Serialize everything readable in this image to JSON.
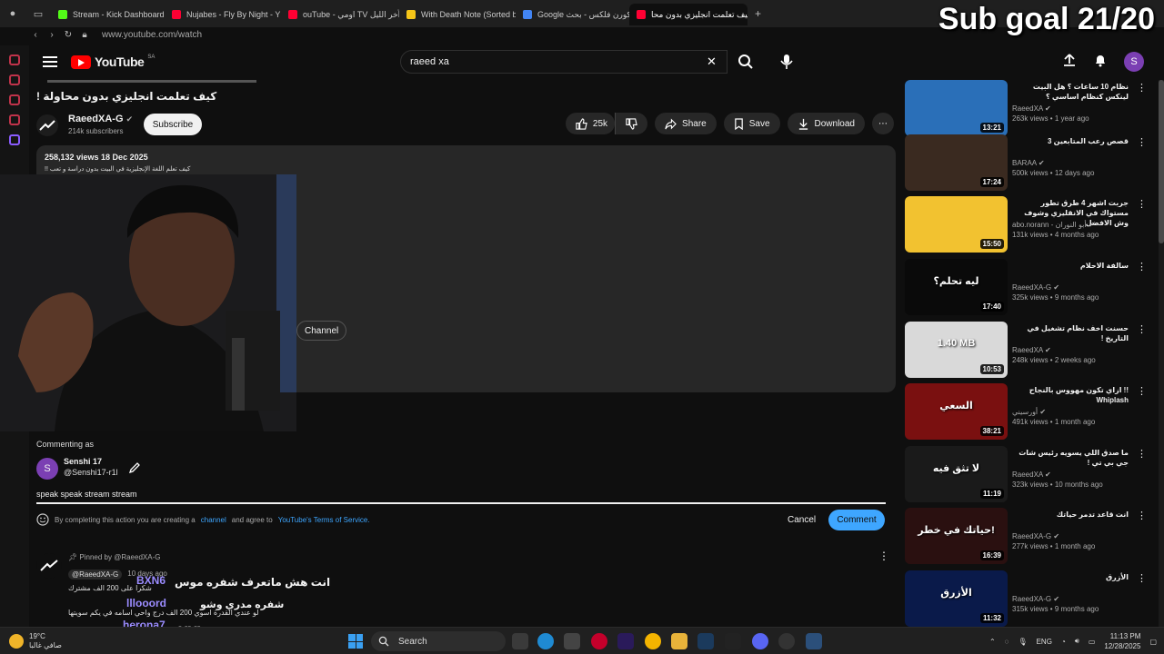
{
  "overlay": {
    "sub_goal": "Sub goal 21/20"
  },
  "browser": {
    "tabs": [
      {
        "label": "Stream - Kick Dashboard",
        "color": "#53fc18"
      },
      {
        "label": "Nujabes - Fly By Night - Y",
        "color": "#ff0033"
      },
      {
        "label": "ouTube - اومي TV آخر الليل",
        "color": "#ff0033"
      },
      {
        "label": "With Death Note (Sorted b",
        "color": "#f5c518"
      },
      {
        "label": "Google كورن فلكس - بحث",
        "color": "#4285f4"
      },
      {
        "label": "كيف تعلمت انجليزي بدون محا",
        "color": "#ff0033",
        "active": true
      }
    ],
    "url": "www.youtube.com/watch"
  },
  "youtube": {
    "logo_text": "YouTube",
    "country": "SA",
    "search_value": "raeed xa",
    "avatar_letter": "S"
  },
  "video": {
    "title": "كيف تعلمت انجليزي بدون محاولة !",
    "channel": "RaeedXA-G",
    "subscribers": "214k subscribers",
    "subscribe_label": "Subscribe",
    "likes": "25k",
    "share_label": "Share",
    "save_label": "Save",
    "download_label": "Download",
    "stats": "258,132 views  18 Dec 2025",
    "description": "كيف تعلم اللغة الإنجليزية في البيت بدون دراسة و تعب !!",
    "channel_pill": "Channel"
  },
  "composer": {
    "commenting_as": "Commenting as",
    "name": "Senshi 17",
    "handle": "@Senshi17-r1l",
    "avatar_letter": "S",
    "input_value": "speak speak stream stream",
    "tos_prefix": "By completing this action you are creating a",
    "tos_link1": "channel",
    "tos_mid": "and agree to",
    "tos_link2": "YouTube's Terms of Service.",
    "cancel_label": "Cancel",
    "comment_label": "Comment"
  },
  "pinned": {
    "pinned_by": "Pinned by @RaeedXA-G",
    "handle": "@RaeedXA-G",
    "time": "10 days ago",
    "line1": "شكرا على 200 الف مشترك",
    "line2": "لو عندي القدرة اسوي 200 الف درج واحي اسامه في يكم سويتها"
  },
  "chat_overlay": [
    {
      "nick": "BXN6",
      "msg": "انت هش ماتعرف شفره موس"
    },
    {
      "nick": "lllooord",
      "msg": "شفره مدري وشو"
    },
    {
      "nick": "herona7",
      "msg": "..-.--.--"
    }
  ],
  "recommendations": [
    {
      "title": "نظام 10 ساعات ؟ هل البيت لينكس كنظام اساسي ؟",
      "channel": "RaeedXA",
      "meta": "263k views • 1 year ago",
      "duration": "13:21",
      "thumb_color": "#2a6fb8"
    },
    {
      "title": "قصص رعب المتابعين 3",
      "channel": "BARAA",
      "meta": "500k views • 12 days ago",
      "duration": "17:24",
      "thumb_color": "#3a2a20"
    },
    {
      "title": "جربت اشهر 4 طرق تطور مستواك في الانقليزي وشوف وش الافضل",
      "channel": "abo.norann - أبو النوران",
      "meta": "131k views • 4 months ago",
      "duration": "15:50",
      "thumb_color": "#f2c230"
    },
    {
      "title": "سالفة الاحلام",
      "channel": "RaeedXA-G",
      "meta": "325k views • 9 months ago",
      "duration": "17:40",
      "thumb_color": "#0a0a0a",
      "thumb_text": "ليه تحلم؟"
    },
    {
      "title": "حسنت اخف نظام تشغيل في التاريخ !",
      "channel": "RaeedXA",
      "meta": "248k views • 2 weeks ago",
      "duration": "10:53",
      "thumb_color": "#d9d9d9",
      "thumb_text": "1.40 MB"
    },
    {
      "title": "!! ازاي تكون مهووس بالنجاح Whiplash",
      "channel": "أورسيني",
      "meta": "491k views • 1 month ago",
      "duration": "38:21",
      "thumb_color": "#7a1010",
      "thumb_text": "السعي"
    },
    {
      "title": "ما صدق اللي يسويه رئيس شات جي بي تي !",
      "channel": "RaeedXA",
      "meta": "323k views • 10 months ago",
      "duration": "11:19",
      "thumb_color": "#1a1a1a",
      "thumb_text": "لا تثق فيه"
    },
    {
      "title": "انت قاعد تدمر حياتك",
      "channel": "RaeedXA-G",
      "meta": "277k views • 1 month ago",
      "duration": "16:39",
      "thumb_color": "#2a1010",
      "thumb_text": "حياتك في خطر!"
    },
    {
      "title": "الأزرق",
      "channel": "RaeedXA-G",
      "meta": "315k views • 9 months ago",
      "duration": "11:32",
      "thumb_color": "#0a1a4a",
      "thumb_text": "الأزرق"
    }
  ],
  "taskbar": {
    "temp": "19°C",
    "weather": "صافي غالبا",
    "search_label": "Search",
    "lang": "ENG",
    "time": "11:13 PM",
    "date": "12/28/2025"
  }
}
